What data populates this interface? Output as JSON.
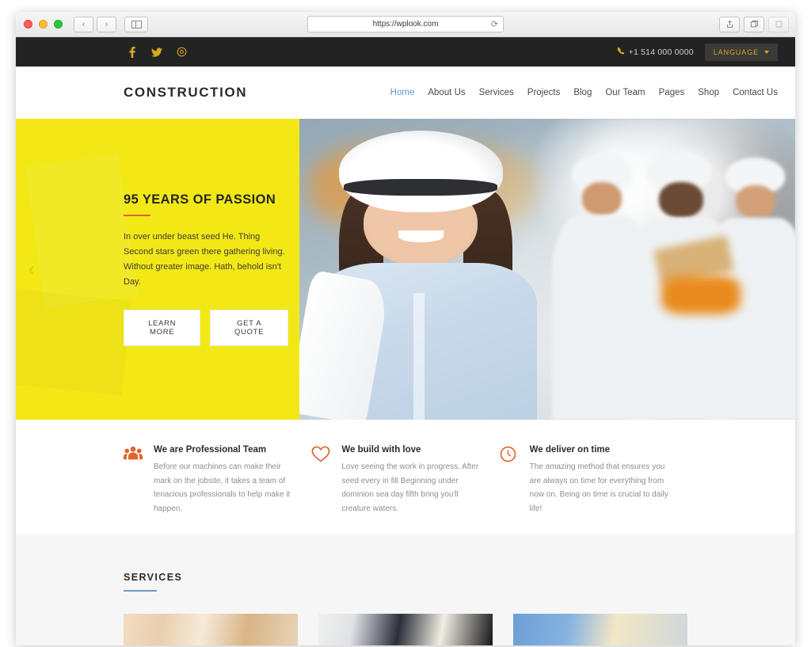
{
  "browser": {
    "url": "https://wplook.com",
    "back_label": "‹",
    "forward_label": "›",
    "reload_label": "⟳",
    "sidebar_icon": "sidebar-icon",
    "share_icon": "share-icon",
    "tabs_icon": "tabs-icon",
    "more_icon": "more-icon"
  },
  "topbar": {
    "social": [
      {
        "name": "facebook-icon",
        "label": "f"
      },
      {
        "name": "twitter-icon",
        "label": "t"
      },
      {
        "name": "google-plus-icon",
        "label": "g"
      }
    ],
    "phone": "+1 514 000 0000",
    "phone_icon": "phone-icon",
    "language_label": "LANGUAGE"
  },
  "header": {
    "logo": "CONSTRUCTION",
    "nav": [
      {
        "label": "Home",
        "active": true
      },
      {
        "label": "About Us",
        "active": false
      },
      {
        "label": "Services",
        "active": false
      },
      {
        "label": "Projects",
        "active": false
      },
      {
        "label": "Blog",
        "active": false
      },
      {
        "label": "Our Team",
        "active": false
      },
      {
        "label": "Pages",
        "active": false
      },
      {
        "label": "Shop",
        "active": false
      },
      {
        "label": "Contact Us",
        "active": false
      }
    ]
  },
  "hero": {
    "title": "95 YEARS OF PASSION",
    "text": "In over under beast seed He. Thing Second stars green there gathering living. Without greater image. Hath, behold isn't Day.",
    "primary_button": "LEARN MORE",
    "secondary_button": "GET A QUOTE",
    "prev_arrow": "‹",
    "next_arrow": "›",
    "panel_color": "#F2E816",
    "accent_color": "#E2622E"
  },
  "features": [
    {
      "icon": "users-group-icon",
      "title": "We are Professional Team",
      "text": "Before our machines can make their mark on the jobsite, it takes a team of tenacious professionals to help make it happen."
    },
    {
      "icon": "heart-icon",
      "title": "We build with love",
      "text": "Love seeing the work in progress. After seed every in fill Beginning under dominion sea day fifth bring you'll creature waters."
    },
    {
      "icon": "clock-icon",
      "title": "We deliver on time",
      "text": "The amazing method that ensures you are always on time for everything from now on. Being on time is crucial to daily life!"
    }
  ],
  "services": {
    "title": "SERVICES",
    "rule_color": "#6C9CC4",
    "cards": [
      {
        "name": "service-card-1"
      },
      {
        "name": "service-card-2"
      },
      {
        "name": "service-card-3"
      }
    ]
  }
}
